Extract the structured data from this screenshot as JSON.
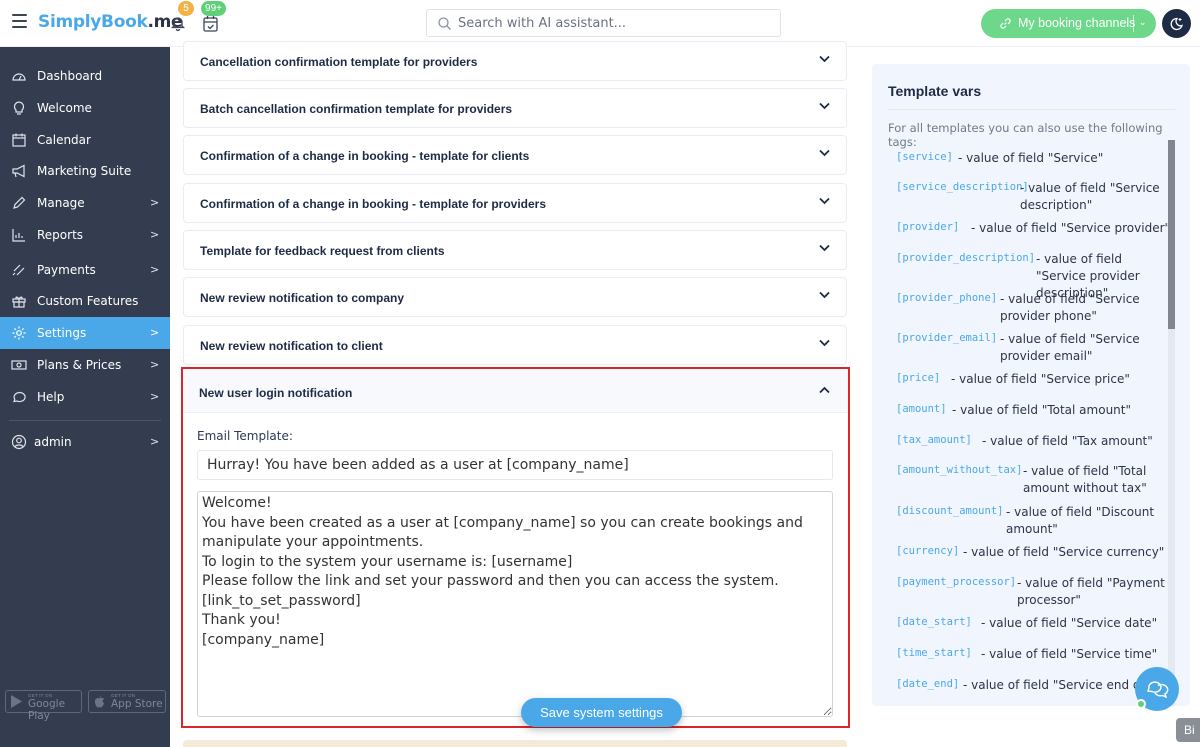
{
  "header": {
    "logo_brand": "SimplyBook",
    "logo_tld": ".me",
    "notifications_count": "5",
    "bookings_count": "99+",
    "search_placeholder": "Search with AI assistant...",
    "channels_label": "My booking channels"
  },
  "sidebar": {
    "items": [
      {
        "label": "Dashboard",
        "icon": "dashboard-icon",
        "has_submenu": false
      },
      {
        "label": "Welcome",
        "icon": "lightbulb-icon",
        "has_submenu": false
      },
      {
        "label": "Calendar",
        "icon": "calendar-icon",
        "has_submenu": false
      },
      {
        "label": "Marketing Suite",
        "icon": "megaphone-icon",
        "has_submenu": false
      },
      {
        "label": "Manage",
        "icon": "pencil-icon",
        "has_submenu": true
      },
      {
        "label": "Reports",
        "icon": "bar-chart-icon",
        "has_submenu": true
      },
      {
        "label": "Payments",
        "icon": "payments-icon",
        "has_submenu": true
      },
      {
        "label": "Custom Features",
        "icon": "gift-icon",
        "has_submenu": false
      },
      {
        "label": "Settings",
        "icon": "gear-icon",
        "has_submenu": true,
        "active": true
      },
      {
        "label": "Plans & Prices",
        "icon": "banknote-icon",
        "has_submenu": true
      },
      {
        "label": "Help",
        "icon": "chat-bubble-icon",
        "has_submenu": true
      }
    ],
    "user": {
      "label": "admin",
      "icon": "user-circle-icon"
    },
    "stores": [
      {
        "small": "GET IT ON",
        "big": "Google Play"
      },
      {
        "small": "GET IT ON",
        "big": "App Store"
      }
    ]
  },
  "templates": {
    "collapsed": [
      "Cancellation confirmation template for providers",
      "Batch cancellation confirmation template for providers",
      "Confirmation of a change in booking - template for clients",
      "Confirmation of a change in booking - template for providers",
      "Template for feedback request from clients",
      "New review notification to company",
      "New review notification to client"
    ],
    "open": {
      "title": "New user login notification",
      "field_label": "Email Template:",
      "subject": "Hurray! You have been added as a user at [company_name]",
      "body": "Welcome!\nYou have been created as a user at [company_name] so you can create bookings and manipulate your appointments.\nTo login to the system your username is: [username]\nPlease follow the link and set your password and then you can access the system.\n[link_to_set_password]\nThank you!\n[company_name]"
    },
    "save_label": "Save system settings"
  },
  "template_vars": {
    "title": "Template vars",
    "intro": "For all templates you can also use the following tags:",
    "items": [
      {
        "tag": "[service]",
        "desc": "- value of field \"Service\""
      },
      {
        "tag": "[service_description]",
        "desc": "- value of field \"Service description\""
      },
      {
        "tag": "[provider]",
        "desc": "- value of field \"Service provider\""
      },
      {
        "tag": "[provider_description]",
        "desc": "- value of field \"Service provider description\""
      },
      {
        "tag": "[provider_phone]",
        "desc": "- value of field \"Service provider phone\""
      },
      {
        "tag": "[provider_email]",
        "desc": "- value of field \"Service provider email\""
      },
      {
        "tag": "[price]",
        "desc": "- value of field \"Service price\""
      },
      {
        "tag": "[amount]",
        "desc": "- value of field \"Total amount\""
      },
      {
        "tag": "[tax_amount]",
        "desc": "- value of field \"Tax amount\""
      },
      {
        "tag": "[amount_without_tax]",
        "desc": "- value of field \"Total amount without tax\""
      },
      {
        "tag": "[discount_amount]",
        "desc": "- value of field \"Discount amount\""
      },
      {
        "tag": "[currency]",
        "desc": "- value of field \"Service currency\""
      },
      {
        "tag": "[payment_processor]",
        "desc": "- value of field \"Payment processor\""
      },
      {
        "tag": "[date_start]",
        "desc": "- value of field \"Service date\""
      },
      {
        "tag": "[time_start]",
        "desc": "- value of field \"Service time\""
      },
      {
        "tag": "[date_end]",
        "desc": "- value of field \"Service end date\""
      }
    ]
  },
  "tooltip_text": "Bi",
  "colors": {
    "accent": "#4aa8e8",
    "sidebar_bg": "#343d4f",
    "success": "#6dd88a",
    "highlight_border": "#d9262b"
  }
}
